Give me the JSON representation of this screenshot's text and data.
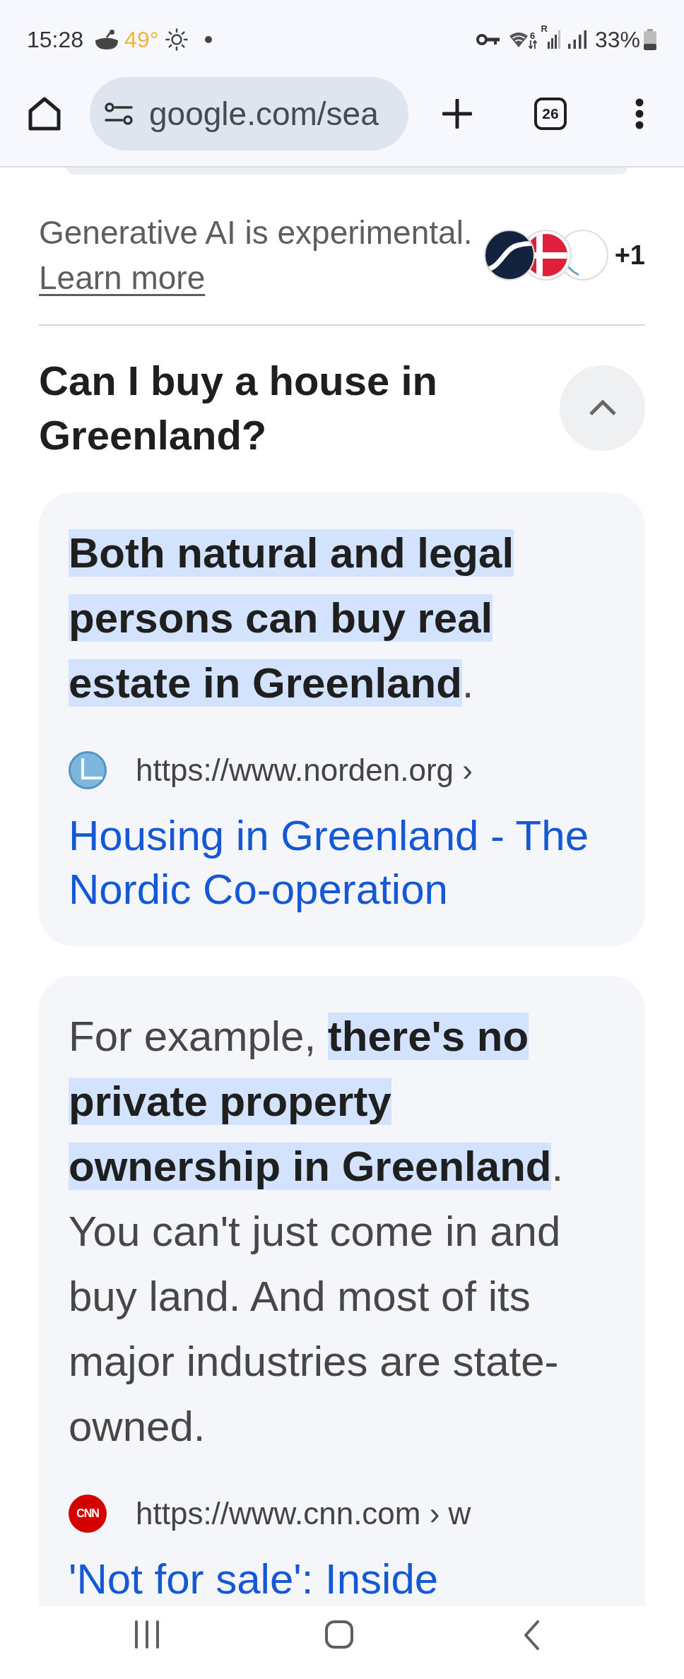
{
  "status_bar": {
    "time": "15:28",
    "temperature": "49°",
    "wifi_label": "6",
    "signal_label": "R",
    "battery": "33%"
  },
  "toolbar": {
    "url": "google.com/sea",
    "tab_count": "26"
  },
  "disclaimer": {
    "text": "Generative AI is experimental.",
    "link": "Learn more",
    "more_sources": "+1"
  },
  "question": {
    "title": "Can I buy a house in Greenland?",
    "expanded": true
  },
  "answers": [
    {
      "text": [
        {
          "text": "Both natural and legal persons can buy real estate in Greenland",
          "highlighted": true
        },
        {
          "text": ".",
          "highlighted": false
        }
      ],
      "source": {
        "url": "https://www.norden.org ›",
        "title": "Housing in Greenland - The Nordic Co-operation"
      }
    },
    {
      "text": [
        {
          "text": "For example, ",
          "highlighted": false
        },
        {
          "text": "there's no private property ownership in Greenland",
          "highlighted": true
        },
        {
          "text": ". You can't just come in and buy land. And most of its major industries are state-owned.",
          "highlighted": false
        }
      ],
      "source": {
        "logo_text": "CNN",
        "url": "https://www.cnn.com › w",
        "title": "'Not for sale': Inside"
      }
    }
  ]
}
